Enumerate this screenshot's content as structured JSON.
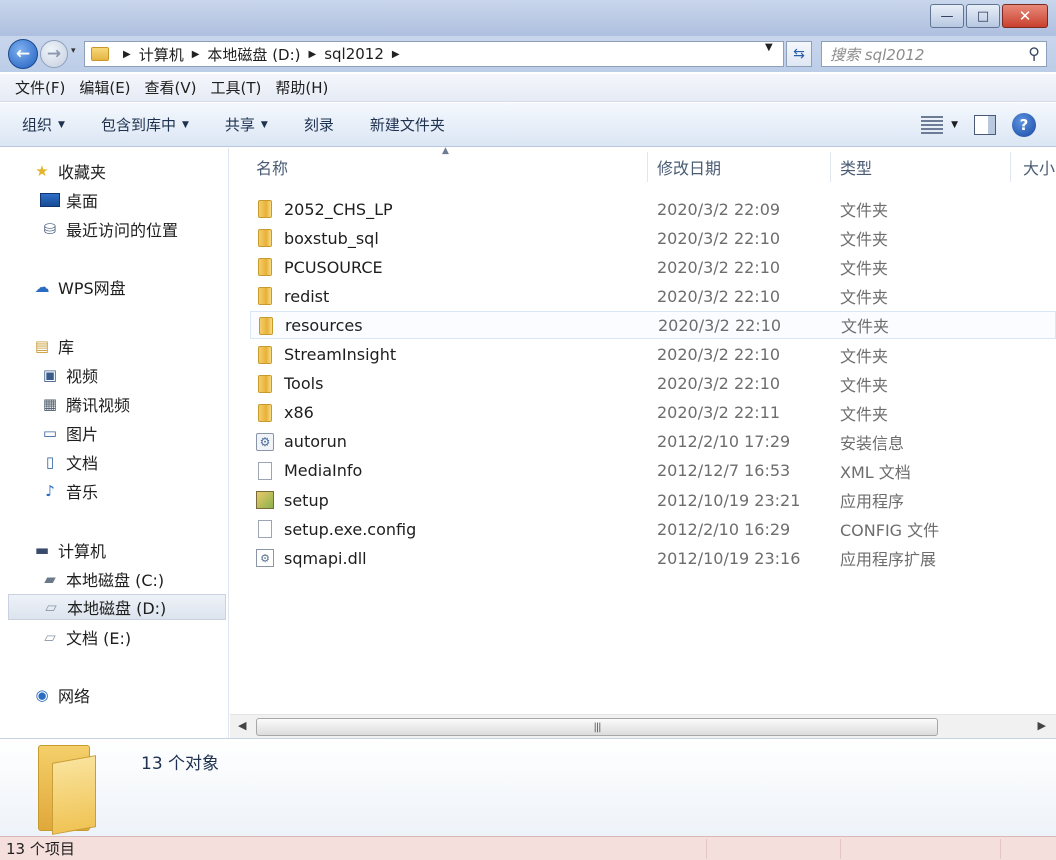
{
  "window": {
    "buttons": {
      "minimize": "—",
      "maximize": "□",
      "close": "✕"
    }
  },
  "address": {
    "crumbs": [
      "计算机",
      "本地磁盘 (D:)",
      "sql2012"
    ],
    "search_placeholder": "搜索 sql2012"
  },
  "menu": [
    "文件(F)",
    "编辑(E)",
    "查看(V)",
    "工具(T)",
    "帮助(H)"
  ],
  "toolbar": {
    "organize": "组织",
    "include_library": "包含到库中",
    "share": "共享",
    "burn": "刻录",
    "new_folder": "新建文件夹"
  },
  "sidebar": {
    "favorites": "收藏夹",
    "desktop": "桌面",
    "recent": "最近访问的位置",
    "wps": "WPS网盘",
    "library": "库",
    "videos": "视频",
    "tencent_video": "腾讯视频",
    "pictures": "图片",
    "documents": "文档",
    "music": "音乐",
    "computer": "计算机",
    "drive_c": "本地磁盘 (C:)",
    "drive_d": "本地磁盘 (D:)",
    "drive_e": "文档 (E:)",
    "network": "网络"
  },
  "columns": {
    "name": "名称",
    "date": "修改日期",
    "type": "类型",
    "size": "大小"
  },
  "files": [
    {
      "name": "2052_CHS_LP",
      "date": "2020/3/2 22:09",
      "type": "文件夹",
      "icon": "folder"
    },
    {
      "name": "boxstub_sql",
      "date": "2020/3/2 22:10",
      "type": "文件夹",
      "icon": "folder"
    },
    {
      "name": "PCUSOURCE",
      "date": "2020/3/2 22:10",
      "type": "文件夹",
      "icon": "folder"
    },
    {
      "name": "redist",
      "date": "2020/3/2 22:10",
      "type": "文件夹",
      "icon": "folder"
    },
    {
      "name": "resources",
      "date": "2020/3/2 22:10",
      "type": "文件夹",
      "icon": "folder"
    },
    {
      "name": "StreamInsight",
      "date": "2020/3/2 22:10",
      "type": "文件夹",
      "icon": "folder"
    },
    {
      "name": "Tools",
      "date": "2020/3/2 22:10",
      "type": "文件夹",
      "icon": "folder"
    },
    {
      "name": "x86",
      "date": "2020/3/2 22:11",
      "type": "文件夹",
      "icon": "folder"
    },
    {
      "name": "autorun",
      "date": "2012/2/10 17:29",
      "type": "安装信息",
      "icon": "settings"
    },
    {
      "name": "MediaInfo",
      "date": "2012/12/7 16:53",
      "type": "XML 文档",
      "icon": "document"
    },
    {
      "name": "setup",
      "date": "2012/10/19 23:21",
      "type": "应用程序",
      "icon": "installer"
    },
    {
      "name": "setup.exe.config",
      "date": "2012/2/10 16:29",
      "type": "CONFIG 文件",
      "icon": "document"
    },
    {
      "name": "sqmapi.dll",
      "date": "2012/10/19 23:16",
      "type": "应用程序扩展",
      "icon": "dll"
    }
  ],
  "details": {
    "count": "13 个对象"
  },
  "status": {
    "items": "13 个项目"
  },
  "colors": {
    "status_bg": "#f5dfdc",
    "accent": "#1f5fbf"
  }
}
